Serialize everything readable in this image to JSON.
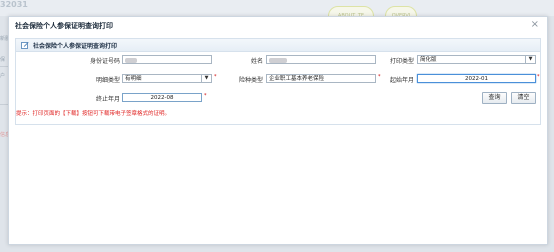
{
  "background": {
    "page_id": "32031",
    "badges": [
      "ABOUT_TE",
      "OVERVI"
    ],
    "side_items": [
      "新服信",
      "保",
      "户",
      "待",
      "信息公"
    ]
  },
  "dialog": {
    "title": "社会保险个人参保证明查询打印",
    "close_label": "×",
    "panel_title": "社会保险个人参保证明查询打印",
    "fields": {
      "id_label": "身份证号码",
      "name_label": "姓名",
      "print_type_label": "打印类型",
      "print_type_value": "简化版",
      "detail_type_label": "明细类型",
      "detail_type_value": "有明细",
      "insurance_type_label": "险种类型",
      "insurance_type_value": "企业职工基本养老保险",
      "start_month_label": "起始年月",
      "start_month_value": "2022-01",
      "end_month_label": "终止年月",
      "end_month_value": "2022-08",
      "required_mark": "*"
    },
    "buttons": {
      "query": "查询",
      "clear": "清空"
    },
    "tip": "提示：打印页面的【下载】按钮可下载带电子签章格式的证明。"
  }
}
